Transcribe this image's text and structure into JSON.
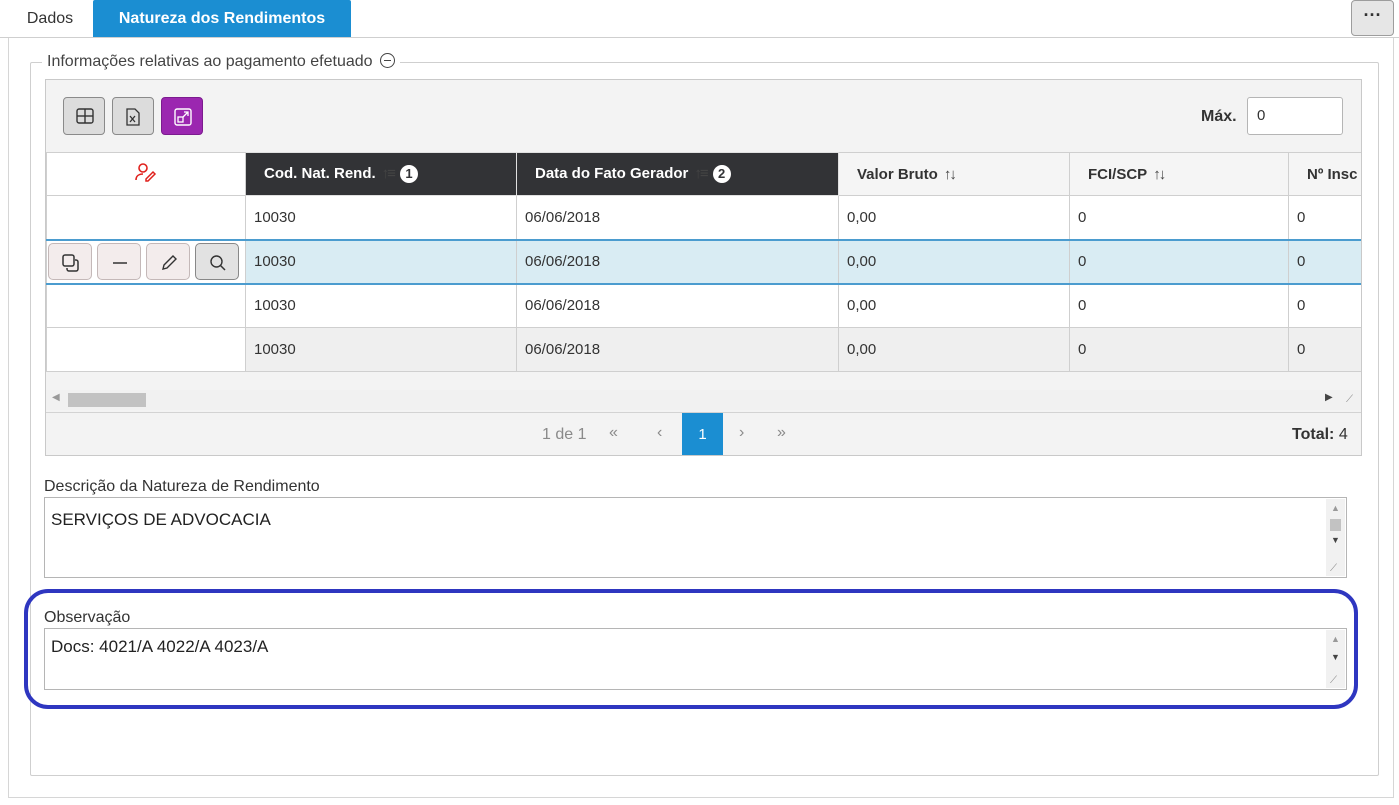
{
  "tabs": [
    {
      "label": "Dados"
    },
    {
      "label": "Natureza dos Rendimentos"
    }
  ],
  "more_button": "···",
  "section": {
    "title": "Informações relativas ao pagamento efetuado"
  },
  "toolbar": {
    "max_label": "Máx.",
    "max_value": "0"
  },
  "table": {
    "columns": [
      {
        "label": "Cod. Nat. Rend.",
        "sort_order": "1"
      },
      {
        "label": "Data do Fato Gerador",
        "sort_order": "2"
      },
      {
        "label": "Valor Bruto"
      },
      {
        "label": "FCI/SCP"
      },
      {
        "label": "Nº Insc"
      }
    ],
    "rows": [
      {
        "cod": "10030",
        "data": "06/06/2018",
        "valor": "0,00",
        "fci": "0",
        "insc": "0"
      },
      {
        "cod": "10030",
        "data": "06/06/2018",
        "valor": "0,00",
        "fci": "0",
        "insc": "0"
      },
      {
        "cod": "10030",
        "data": "06/06/2018",
        "valor": "0,00",
        "fci": "0",
        "insc": "0"
      },
      {
        "cod": "10030",
        "data": "06/06/2018",
        "valor": "0,00",
        "fci": "0",
        "insc": "0"
      }
    ]
  },
  "pager": {
    "page_info": "1 de 1",
    "first": "«",
    "prev": "‹",
    "current": "1",
    "next": "›",
    "last": "»",
    "total_label": "Total:",
    "total_value": "4"
  },
  "descricao": {
    "label": "Descrição da Natureza de Rendimento",
    "value": "SERVIÇOS DE ADVOCACIA"
  },
  "observacao": {
    "label": "Observação",
    "value": "Docs: 4021/A  4022/A  4023/A"
  },
  "colors": {
    "accent": "#1b8ed2",
    "header_dark": "#323336",
    "selected_row": "#d9ecf3",
    "highlight_ring": "#2e36c0",
    "purple_button": "#9b27b0",
    "user_icon": "#e0201c"
  }
}
